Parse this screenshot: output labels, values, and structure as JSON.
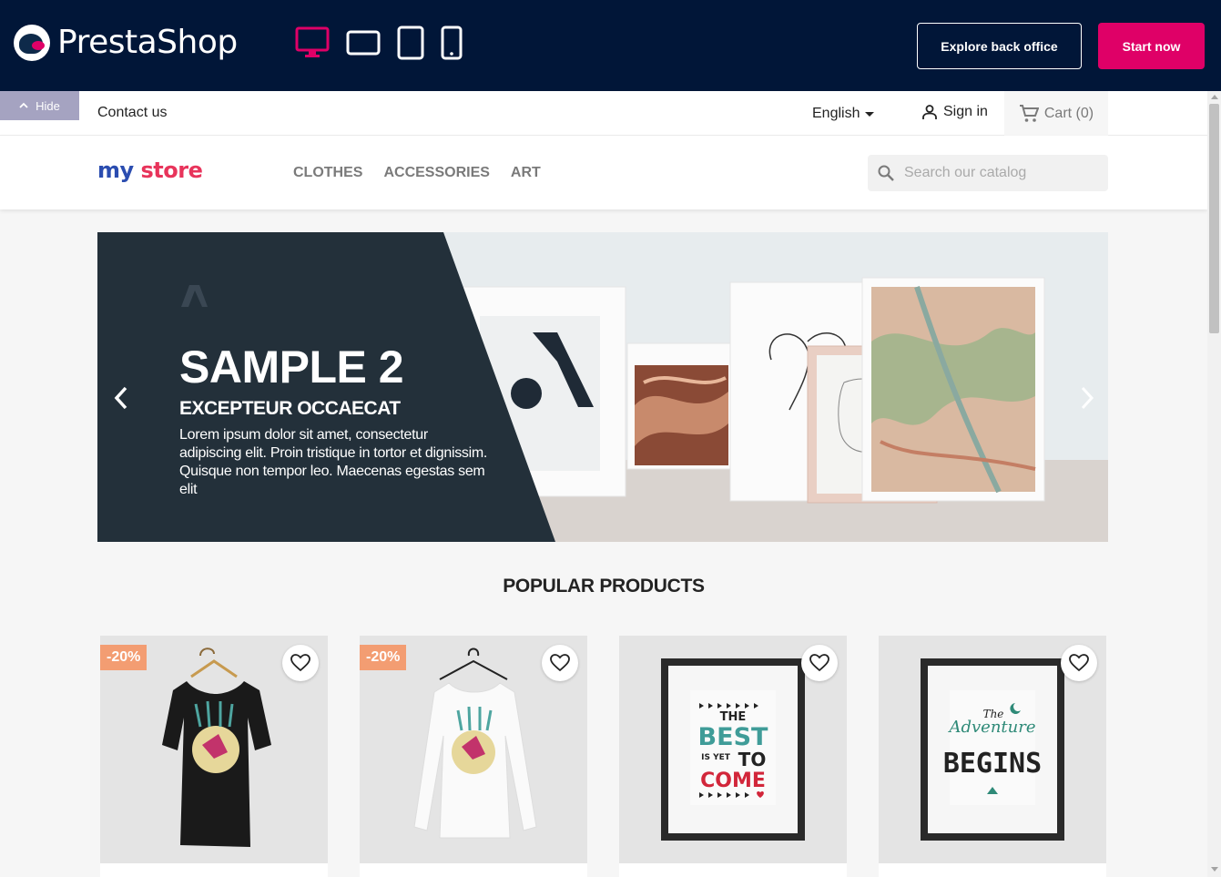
{
  "demo_bar": {
    "brand": "PrestaShop",
    "devices": [
      "desktop-icon",
      "tablet-landscape-icon",
      "tablet-icon",
      "mobile-icon"
    ],
    "explore_label": "Explore back office",
    "start_label": "Start now",
    "hide_label": "Hide",
    "colors": {
      "background": "#011638",
      "accent": "#df0067"
    }
  },
  "header": {
    "contact": "Contact us",
    "language": "English",
    "sign_in": "Sign in",
    "cart": "Cart (0)",
    "logo_part1": "my",
    "logo_part2": "store",
    "menu": [
      "CLOTHES",
      "ACCESSORIES",
      "ART"
    ],
    "search_placeholder": "Search our catalog"
  },
  "slider": {
    "title": "SAMPLE 2",
    "subtitle": "EXCEPTEUR OCCAECAT",
    "description": "Lorem ipsum dolor sit amet, consectetur adipiscing elit. Proin tristique in tortor et dignissim. Quisque non tempor leo. Maecenas egestas sem elit"
  },
  "popular": {
    "heading": "POPULAR PRODUCTS",
    "products": [
      {
        "discount": "-20%",
        "image": "black-tshirt-hummingbird"
      },
      {
        "discount": "-20%",
        "image": "white-sweater-hummingbird"
      },
      {
        "discount": "",
        "image": "framed-poster-best-is-yet-to-come",
        "poster_lines": [
          "THE",
          "BEST",
          "IS YET",
          "TO",
          "COME"
        ]
      },
      {
        "discount": "",
        "image": "framed-poster-adventure-begins",
        "poster_lines": [
          "The",
          "Adventure",
          "BEGINS"
        ]
      }
    ]
  }
}
